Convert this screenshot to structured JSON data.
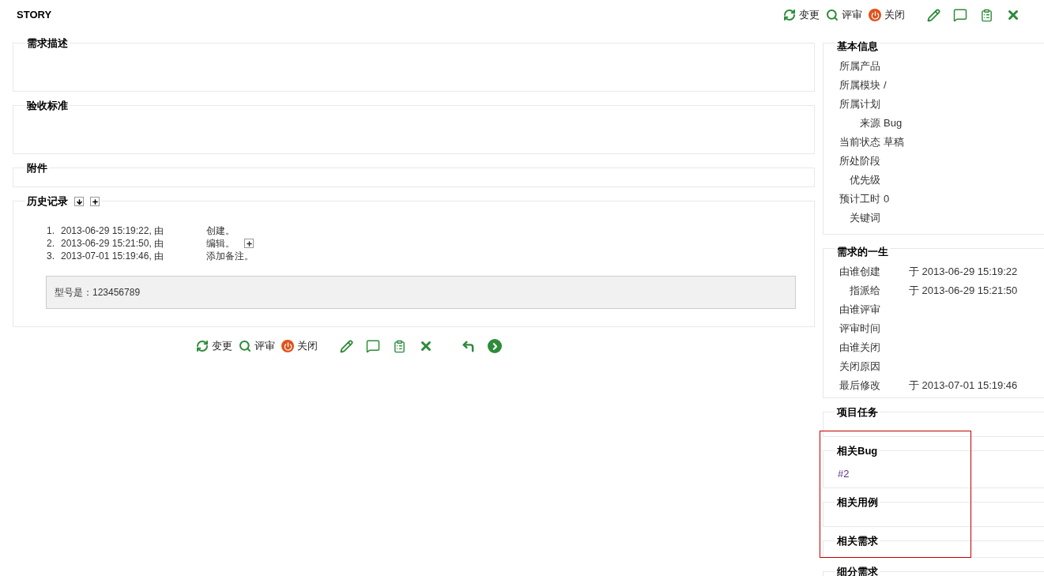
{
  "title": "STORY",
  "top_actions": [
    {
      "kind": "change",
      "label": "变更"
    },
    {
      "kind": "review",
      "label": "评审"
    },
    {
      "kind": "close",
      "label": "关闭"
    },
    {
      "kind": "edit"
    },
    {
      "kind": "comment"
    },
    {
      "kind": "copy"
    },
    {
      "kind": "delete"
    }
  ],
  "sections": [
    {
      "legend": "需求描述",
      "kind": "text"
    },
    {
      "legend": "验收标准",
      "kind": "text"
    },
    {
      "legend": "附件",
      "kind": "files"
    }
  ],
  "history": {
    "legend": "历史记录",
    "entries": [
      {
        "number": "1.",
        "time": "2013-06-29 15:19:22, 由",
        "action": "创建。",
        "has_changes": false
      },
      {
        "number": "2.",
        "time": "2013-06-29 15:21:50, 由",
        "action": "编辑。",
        "has_changes": true
      },
      {
        "number": "3.",
        "time": "2013-07-01 15:19:46, 由",
        "action": "添加备注。",
        "has_changes": false
      }
    ],
    "comment": "型号是：123456789"
  },
  "bottom_actions": [
    {
      "kind": "change",
      "label": "变更"
    },
    {
      "kind": "review",
      "label": "评审"
    },
    {
      "kind": "close",
      "label": "关闭"
    },
    {
      "kind": "edit"
    },
    {
      "kind": "comment"
    },
    {
      "kind": "copy"
    },
    {
      "kind": "delete"
    },
    {
      "kind": "back"
    },
    {
      "kind": "next"
    }
  ],
  "basic_info": {
    "legend": "基本信息",
    "rows": [
      {
        "label": "所属产品"
      },
      {
        "label": "所属模块",
        "value": "/"
      },
      {
        "label": "所属计划"
      },
      {
        "label": "来源",
        "value": "Bug"
      },
      {
        "label": "当前状态",
        "value": "草稿"
      },
      {
        "label": "所处阶段"
      },
      {
        "label": "优先级"
      },
      {
        "label": "预计工时",
        "value": "0"
      },
      {
        "label": "关键词"
      }
    ]
  },
  "life": {
    "legend": "需求的一生",
    "rows": [
      {
        "label": "由谁创建",
        "value": "于 2013-06-29 15:19:22"
      },
      {
        "label": "指派给",
        "value": "于 2013-06-29 15:21:50"
      },
      {
        "label": "由谁评审"
      },
      {
        "label": "评审时间"
      },
      {
        "label": "由谁关闭"
      },
      {
        "label": "关闭原因"
      },
      {
        "label": "最后修改",
        "value": "于 2013-07-01 15:19:46"
      }
    ]
  },
  "related": [
    {
      "kind": "section",
      "legend": "项目任务"
    },
    {
      "kind": "marked_group",
      "sections": [
        {
          "legend": "相关Bug",
          "links": [
            "#2"
          ]
        },
        {
          "legend": "相关用例"
        },
        {
          "legend": "相关需求"
        }
      ]
    },
    {
      "kind": "section",
      "legend": "细分需求"
    }
  ]
}
